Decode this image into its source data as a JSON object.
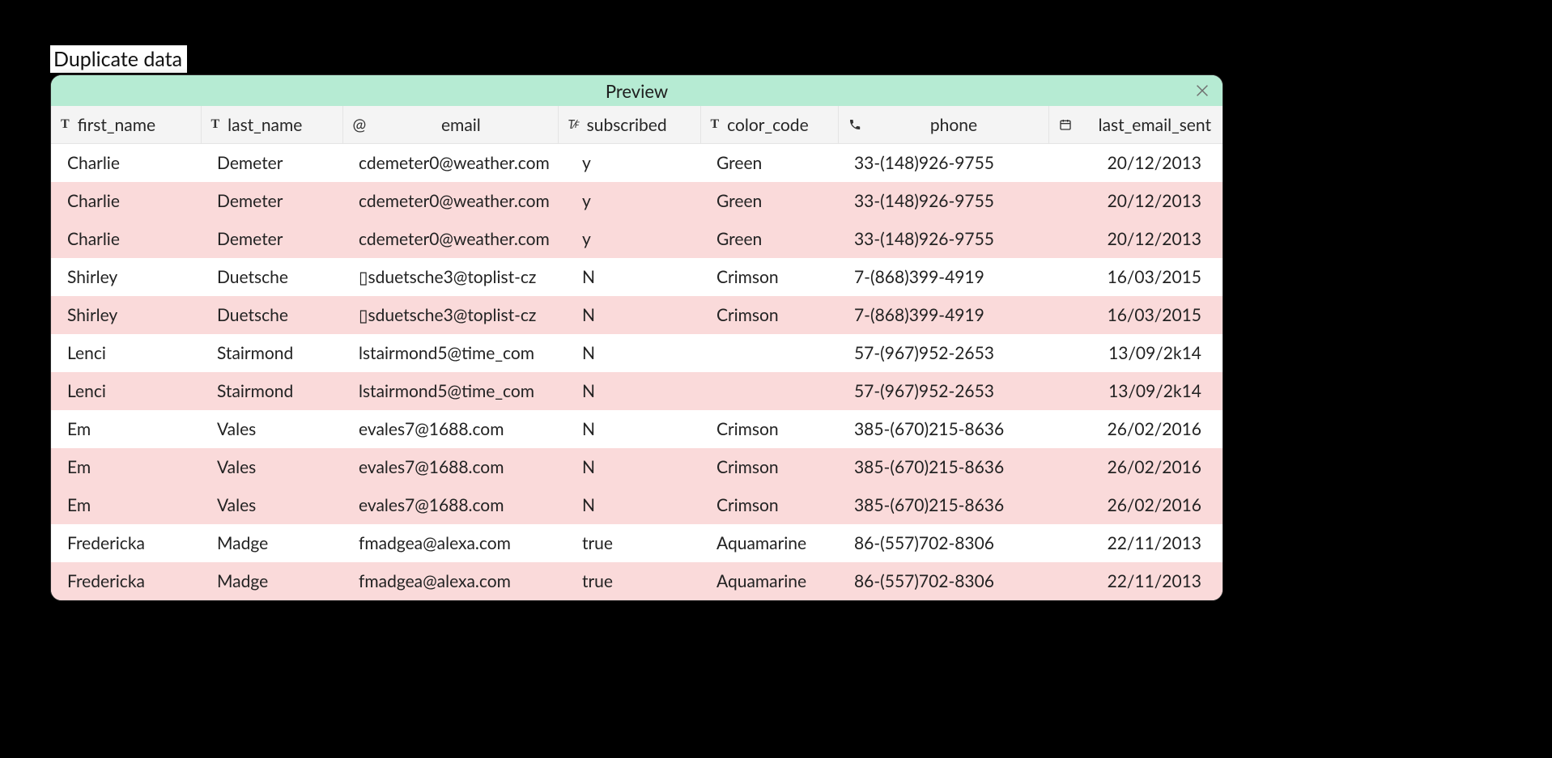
{
  "page": {
    "title": "Duplicate data"
  },
  "panel": {
    "title": "Preview"
  },
  "columns": [
    {
      "key": "first_name",
      "label": "first_name",
      "icon": "text",
      "align": "left"
    },
    {
      "key": "last_name",
      "label": "last_name",
      "icon": "text",
      "align": "left"
    },
    {
      "key": "email",
      "label": "email",
      "icon": "at",
      "align": "center"
    },
    {
      "key": "subscribed",
      "label": "subscribed",
      "icon": "bool",
      "align": "left"
    },
    {
      "key": "color_code",
      "label": "color_code",
      "icon": "text",
      "align": "left"
    },
    {
      "key": "phone",
      "label": "phone",
      "icon": "phone",
      "align": "center"
    },
    {
      "key": "last_email_sent",
      "label": "last_email_sent",
      "icon": "date",
      "align": "right"
    }
  ],
  "rows": [
    {
      "dup": false,
      "first_name": "Charlie",
      "last_name": "Demeter",
      "email": "cdemeter0@weather.com",
      "subscribed": "y",
      "color_code": "Green",
      "phone": "33-(148)926-9755",
      "last_email_sent": "20/12/2013"
    },
    {
      "dup": true,
      "first_name": "Charlie",
      "last_name": "Demeter",
      "email": "cdemeter0@weather.com",
      "subscribed": "y",
      "color_code": "Green",
      "phone": "33-(148)926-9755",
      "last_email_sent": "20/12/2013"
    },
    {
      "dup": true,
      "first_name": "Charlie",
      "last_name": "Demeter",
      "email": "cdemeter0@weather.com",
      "subscribed": "y",
      "color_code": "Green",
      "phone": "33-(148)926-9755",
      "last_email_sent": "20/12/2013"
    },
    {
      "dup": false,
      "first_name": "Shirley",
      "last_name": "Duetsche",
      "email": "▯sduetsche3@toplist-cz",
      "subscribed": "N",
      "color_code": "Crimson",
      "phone": "7-(868)399-4919",
      "last_email_sent": "16/03/2015"
    },
    {
      "dup": true,
      "first_name": "Shirley",
      "last_name": "Duetsche",
      "email": "▯sduetsche3@toplist-cz",
      "subscribed": "N",
      "color_code": "Crimson",
      "phone": "7-(868)399-4919",
      "last_email_sent": "16/03/2015"
    },
    {
      "dup": false,
      "first_name": "Lenci",
      "last_name": "Stairmond",
      "email": "lstairmond5@time_com",
      "subscribed": "N",
      "color_code": "",
      "phone": "57-(967)952-2653",
      "last_email_sent": "13/09/2k14"
    },
    {
      "dup": true,
      "first_name": "Lenci",
      "last_name": "Stairmond",
      "email": "lstairmond5@time_com",
      "subscribed": "N",
      "color_code": "",
      "phone": "57-(967)952-2653",
      "last_email_sent": "13/09/2k14"
    },
    {
      "dup": false,
      "first_name": "Em",
      "last_name": "Vales",
      "email": "evales7@1688.com",
      "subscribed": "N",
      "color_code": "Crimson",
      "phone": "385-(670)215-8636",
      "last_email_sent": "26/02/2016"
    },
    {
      "dup": true,
      "first_name": "Em",
      "last_name": "Vales",
      "email": "evales7@1688.com",
      "subscribed": "N",
      "color_code": "Crimson",
      "phone": "385-(670)215-8636",
      "last_email_sent": "26/02/2016"
    },
    {
      "dup": true,
      "first_name": "Em",
      "last_name": "Vales",
      "email": "evales7@1688.com",
      "subscribed": "N",
      "color_code": "Crimson",
      "phone": "385-(670)215-8636",
      "last_email_sent": "26/02/2016"
    },
    {
      "dup": false,
      "first_name": "Fredericka",
      "last_name": "Madge",
      "email": "fmadgea@alexa.com",
      "subscribed": "true",
      "color_code": "Aquamarine",
      "phone": "86-(557)702-8306",
      "last_email_sent": "22/11/2013"
    },
    {
      "dup": true,
      "first_name": "Fredericka",
      "last_name": "Madge",
      "email": "fmadgea@alexa.com",
      "subscribed": "true",
      "color_code": "Aquamarine",
      "phone": "86-(557)702-8306",
      "last_email_sent": "22/11/2013"
    }
  ],
  "colors": {
    "header_bg": "#b6ebd3",
    "dup_row_bg": "#fadada"
  }
}
